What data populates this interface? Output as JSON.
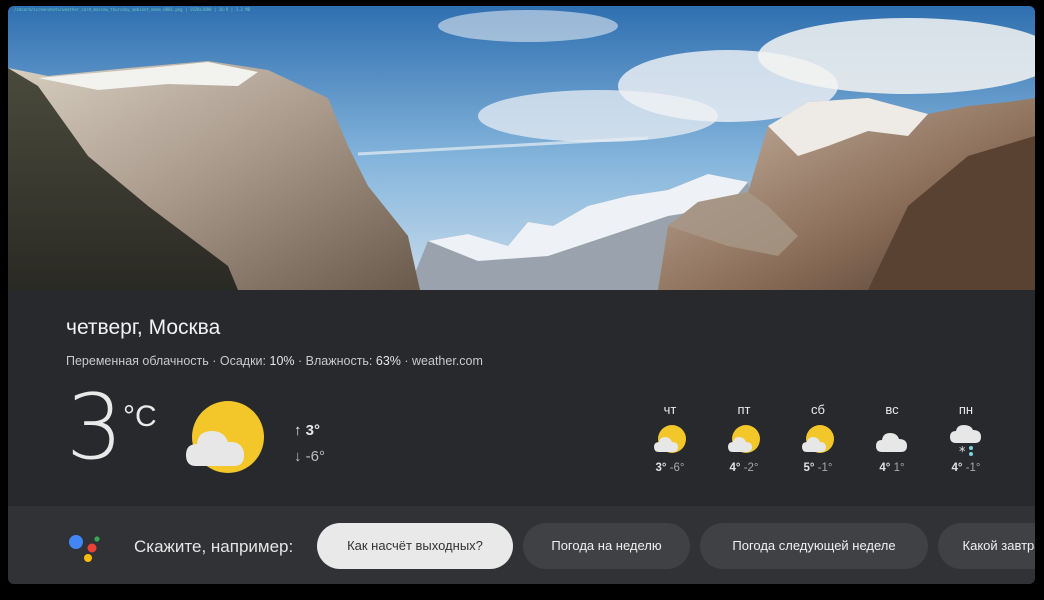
{
  "debug_text": "/sdcard/screenshots/weather_card_moscow_thursday_ambient_mode_0001.png | 1920x1080 | 16:9 | 3.2 MB",
  "weather": {
    "title": "четверг, Москва",
    "conditions": "Переменная облачность",
    "sep": " · ",
    "precip_label": "Осадки: ",
    "precip_value": "10%",
    "humidity_label": "Влажность: ",
    "humidity_value": "63%",
    "source": "weather.com",
    "temperature": "3",
    "unit": "°C",
    "high": "↑ 3°",
    "low": "↓ -6°",
    "icon": "partly-cloudy-icon"
  },
  "forecast": [
    {
      "day": "чт",
      "high": "3°",
      "low": "-6°",
      "icon": "partly-cloudy-icon"
    },
    {
      "day": "пт",
      "high": "4°",
      "low": "-2°",
      "icon": "partly-cloudy-icon"
    },
    {
      "day": "сб",
      "high": "5°",
      "low": "-1°",
      "icon": "partly-cloudy-icon"
    },
    {
      "day": "вс",
      "high": "4°",
      "low": "1°",
      "icon": "cloud-icon"
    },
    {
      "day": "пн",
      "high": "4°",
      "low": "-1°",
      "icon": "snow-cloud-icon"
    }
  ],
  "assistant": {
    "prompt": "Скажите, например:",
    "icon": "google-assistant-icon",
    "suggestions": [
      "Как насчёт выходных?",
      "Погода на неделю",
      "Погода следующей неделе",
      "Какой завтра"
    ]
  },
  "colors": {
    "sun": "#f3c629",
    "cloud": "#e7e7e7",
    "card_bg": "#27292d",
    "bar_bg": "#303236",
    "chip_bg": "#3f4145",
    "chip_active_bg": "#e9e9ea"
  }
}
